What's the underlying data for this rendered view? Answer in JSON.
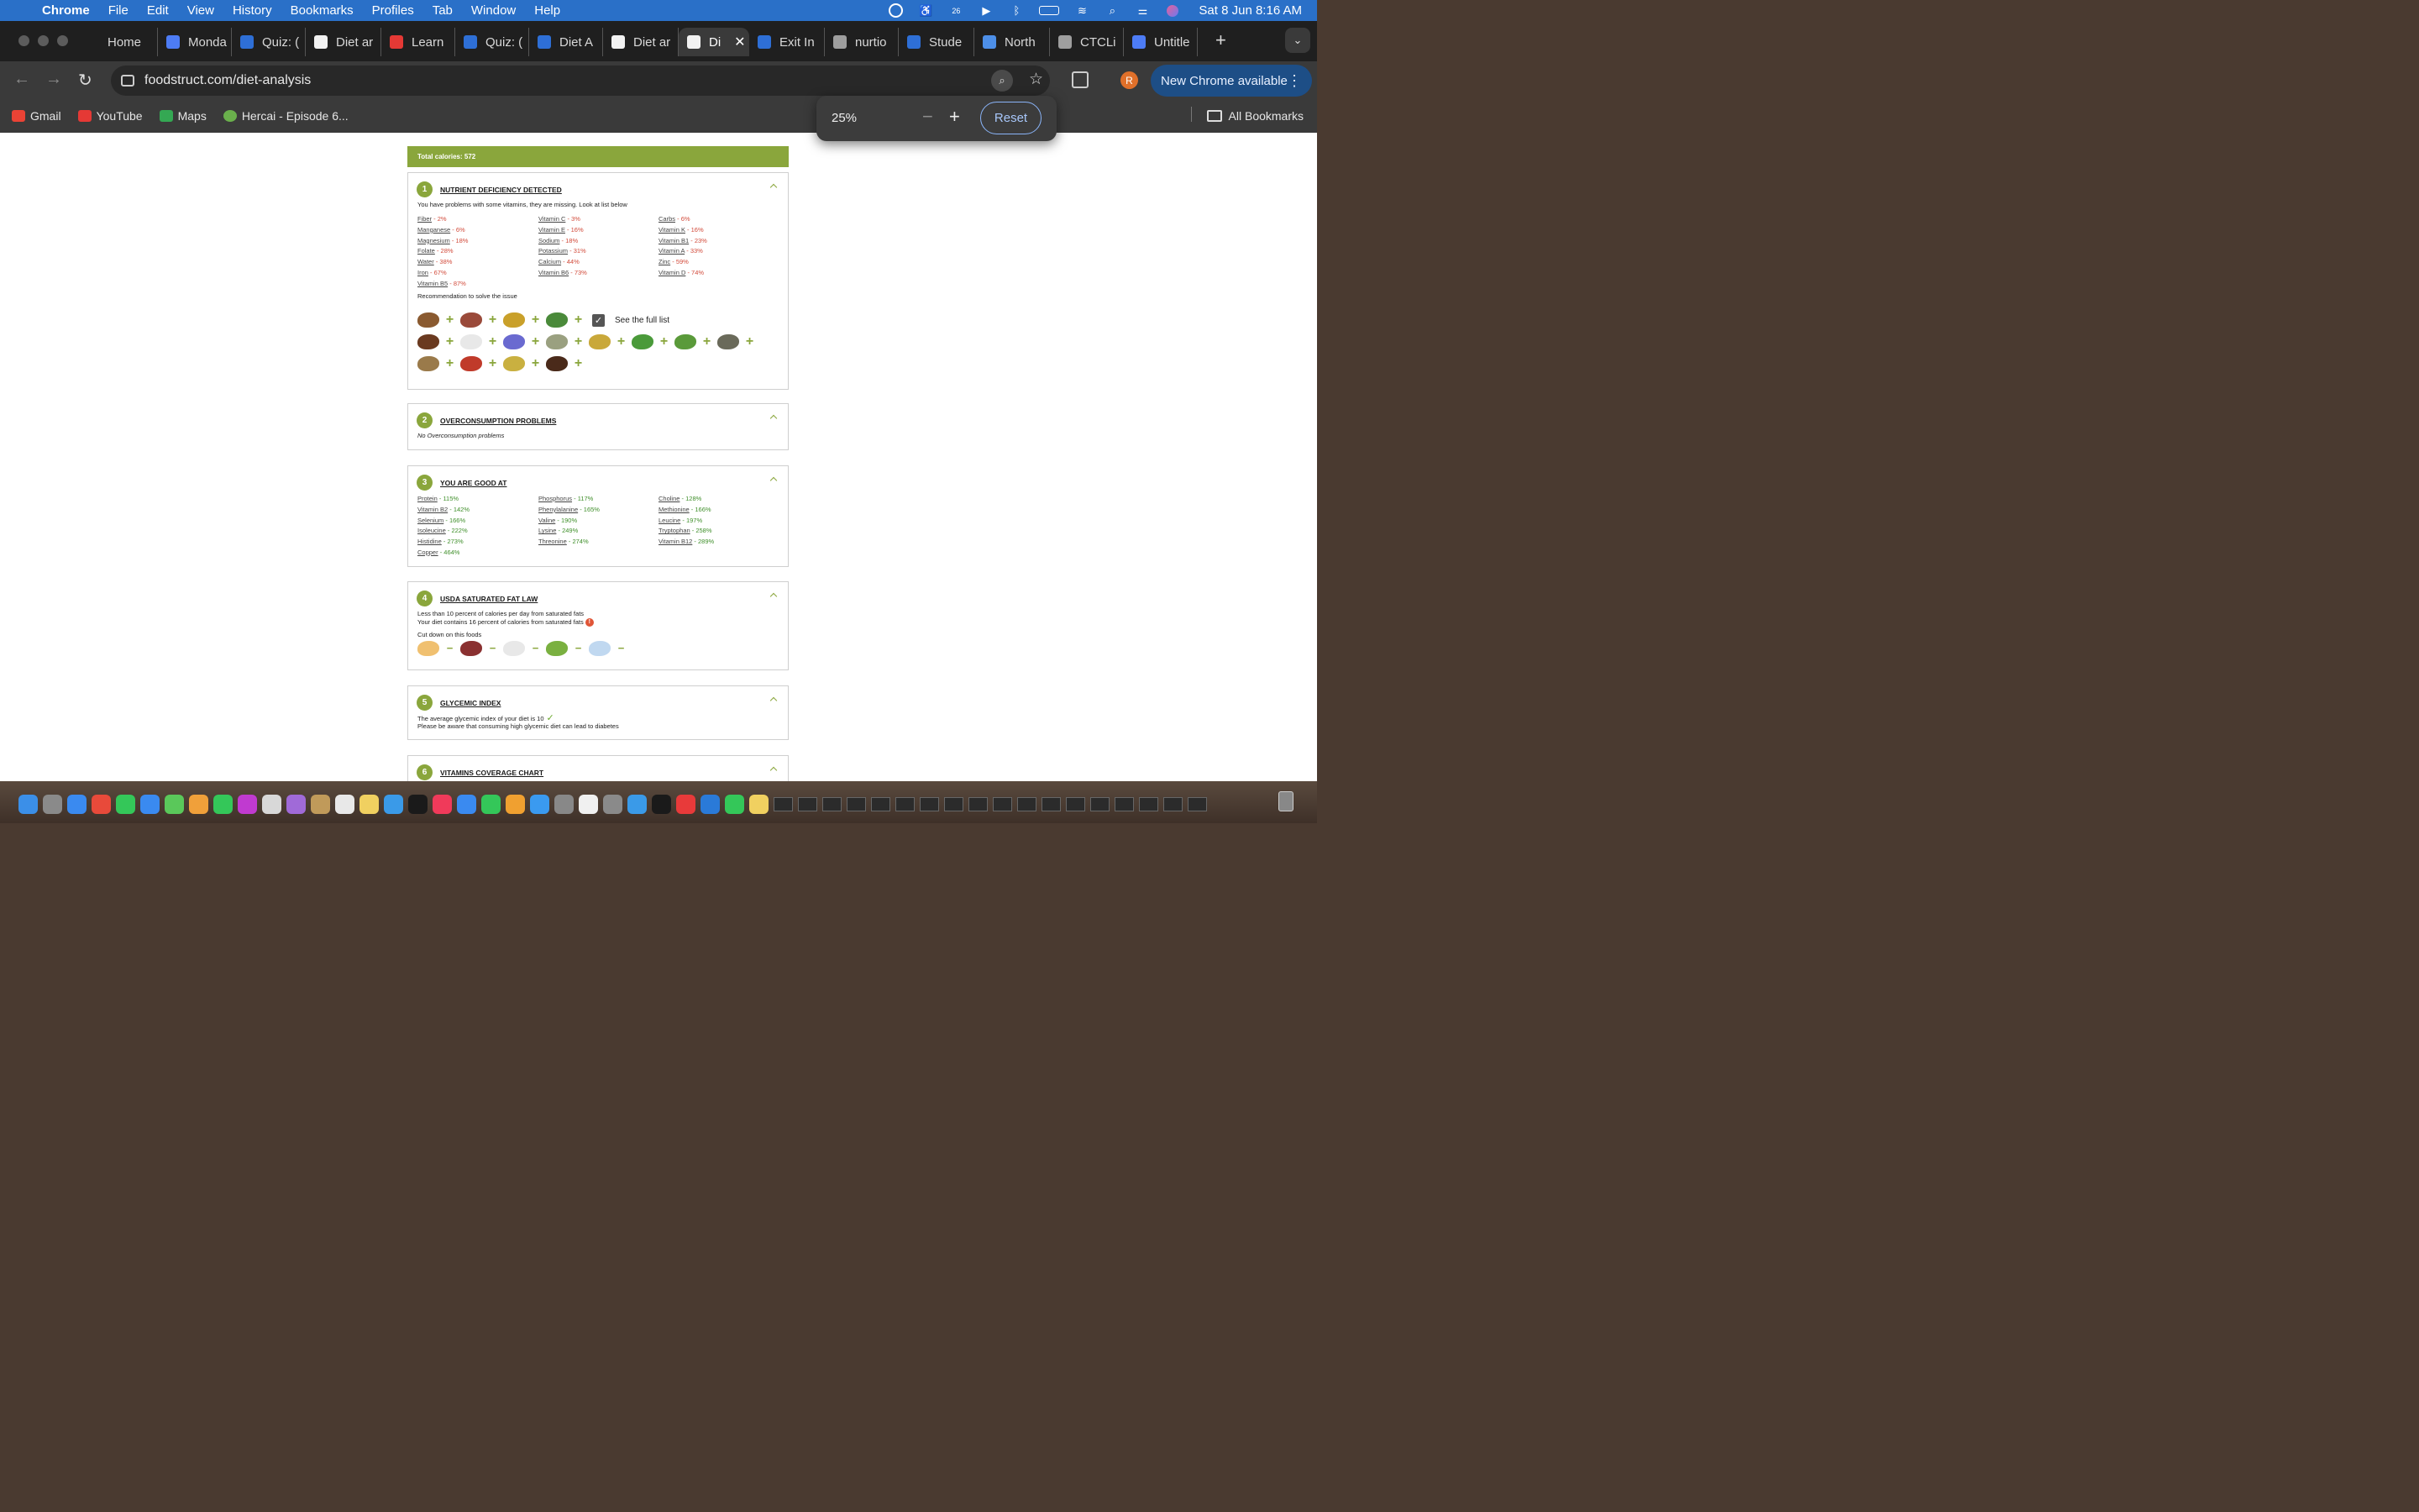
{
  "menubar": {
    "app": "Chrome",
    "items": [
      "File",
      "Edit",
      "View",
      "History",
      "Bookmarks",
      "Profiles",
      "Tab",
      "Window",
      "Help"
    ],
    "clock": "Sat 8 Jun  8:16 AM",
    "badge": "26"
  },
  "tabs": [
    {
      "label": "Home",
      "color": "#1f1f1f"
    },
    {
      "label": "Monda",
      "color": "#4d7cf5"
    },
    {
      "label": "Quiz: (",
      "color": "#2e6fd6"
    },
    {
      "label": "Diet ar",
      "color": "#f2f2f2"
    },
    {
      "label": "Learn",
      "color": "#e53935"
    },
    {
      "label": "Quiz: (",
      "color": "#2e6fd6"
    },
    {
      "label": "Diet A",
      "color": "#2e6fd6"
    },
    {
      "label": "Diet ar",
      "color": "#f2f2f2"
    },
    {
      "label": "Di",
      "color": "#f2f2f2",
      "active": true
    },
    {
      "label": "Exit In",
      "color": "#2e6fd6"
    },
    {
      "label": "nurtio",
      "color": "#9e9e9e"
    },
    {
      "label": "Stude",
      "color": "#2e6fd6"
    },
    {
      "label": "North",
      "color": "#4d8fe8"
    },
    {
      "label": "CTCLi",
      "color": "#9e9e9e"
    },
    {
      "label": "Untitle",
      "color": "#4d7cf5"
    }
  ],
  "url": "foodstruct.com/diet-analysis",
  "profile_initial": "R",
  "new_chrome": "New Chrome available",
  "bookmarks": [
    {
      "label": "Gmail",
      "color": "#ea4335"
    },
    {
      "label": "YouTube",
      "color": "#e53935"
    },
    {
      "label": "Maps",
      "color": "#34a853"
    },
    {
      "label": "Hercai - Episode 6...",
      "color": "#6ab04c"
    }
  ],
  "all_bookmarks": "All Bookmarks",
  "zoom": {
    "value": "25%",
    "reset": "Reset"
  },
  "page": {
    "total_calories": "Total calories: 572",
    "s1": {
      "num": "1",
      "title": "NUTRIENT DEFICIENCY DETECTED",
      "desc": "You have problems with some vitamins, they are missing. Look at list below",
      "col1": [
        [
          "Fiber",
          "2%"
        ],
        [
          "Manganese",
          "6%"
        ],
        [
          "Magnesium",
          "18%"
        ],
        [
          "Folate",
          "28%"
        ],
        [
          "Water",
          "38%"
        ],
        [
          "Iron",
          "67%"
        ],
        [
          "Vitamin B5",
          "87%"
        ]
      ],
      "col2": [
        [
          "Vitamin C",
          "3%"
        ],
        [
          "Vitamin E",
          "16%"
        ],
        [
          "Sodium",
          "18%"
        ],
        [
          "Potassium",
          "31%"
        ],
        [
          "Calcium",
          "44%"
        ],
        [
          "Vitamin B6",
          "73%"
        ]
      ],
      "col3": [
        [
          "Carbs",
          "6%"
        ],
        [
          "Vitamin K",
          "16%"
        ],
        [
          "Vitamin B1",
          "23%"
        ],
        [
          "Vitamin A",
          "33%"
        ],
        [
          "Zinc",
          "59%"
        ],
        [
          "Vitamin D",
          "74%"
        ]
      ],
      "recommend": "Recommendation to solve the issue",
      "see_full": "See the full list"
    },
    "s2": {
      "num": "2",
      "title": "OVERCONSUMPTION PROBLEMS",
      "desc": "No Overconsumption problems"
    },
    "s3": {
      "num": "3",
      "title": "YOU ARE GOOD AT",
      "col1": [
        [
          "Protein",
          "115%"
        ],
        [
          "Vitamin B2",
          "142%"
        ],
        [
          "Selenium",
          "166%"
        ],
        [
          "Isoleucine",
          "222%"
        ],
        [
          "Histidine",
          "273%"
        ],
        [
          "Copper",
          "464%"
        ]
      ],
      "col2": [
        [
          "Phosphorus",
          "117%"
        ],
        [
          "Phenylalanine",
          "165%"
        ],
        [
          "Valine",
          "190%"
        ],
        [
          "Lysine",
          "249%"
        ],
        [
          "Threonine",
          "274%"
        ]
      ],
      "col3": [
        [
          "Choline",
          "128%"
        ],
        [
          "Methionine",
          "166%"
        ],
        [
          "Leucine",
          "197%"
        ],
        [
          "Tryptophan",
          "258%"
        ],
        [
          "Vitamin B12",
          "289%"
        ]
      ]
    },
    "s4": {
      "num": "4",
      "title": "USDA SATURATED FAT LAW",
      "line1": "Less than 10 percent of calories per day from saturated fats",
      "line2": "Your diet contains 16 percent of calories from saturated fats",
      "cut": "Cut down on this foods"
    },
    "s5": {
      "num": "5",
      "title": "GLYCEMIC INDEX",
      "line1": "The average glycemic index of your diet is 10",
      "line2": "Please be aware that consuming high glycemic diet can lead to diabetes"
    },
    "s6": {
      "num": "6",
      "title": "VITAMINS COVERAGE CHART"
    }
  },
  "food_colors": {
    "row1": [
      "#8a5a30",
      "#9a4a3a",
      "#c9a02a",
      "#4a8a3a"
    ],
    "row2": [
      "#6a3a20",
      "#e8e8e8",
      "#6a6ad0",
      "#9aa080",
      "#c9a83a",
      "#4a9a3a",
      "#5a9a3a",
      "#6a6a5a"
    ],
    "row3": [
      "#9a7a4a",
      "#c03a2a",
      "#c9b040",
      "#4a2a1a"
    ],
    "cut": [
      "#f0c070",
      "#8a3030",
      "#e8e8e8",
      "#7ab040",
      "#c0d8f0"
    ]
  },
  "dock_colors": [
    "#3b8fe8",
    "#8a8a8a",
    "#3a8af0",
    "#e84a3a",
    "#34c759",
    "#3a8af0",
    "#5ac85a",
    "#f0a03a",
    "#34c759",
    "#c03ad0",
    "#d8d8d8",
    "#a06ad8",
    "#c09a5a",
    "#e8e8e8",
    "#f0d060",
    "#3a9ae8",
    "#1a1a1a",
    "#f03a5a",
    "#3a8af0",
    "#34c759",
    "#f0a030",
    "#3a9af0",
    "#888888",
    "#f0f0f0",
    "#8a8a8a",
    "#3a9ae8",
    "#1a1a1a",
    "#e83a3a",
    "#2a7ad8",
    "#34c759",
    "#f0d060"
  ]
}
